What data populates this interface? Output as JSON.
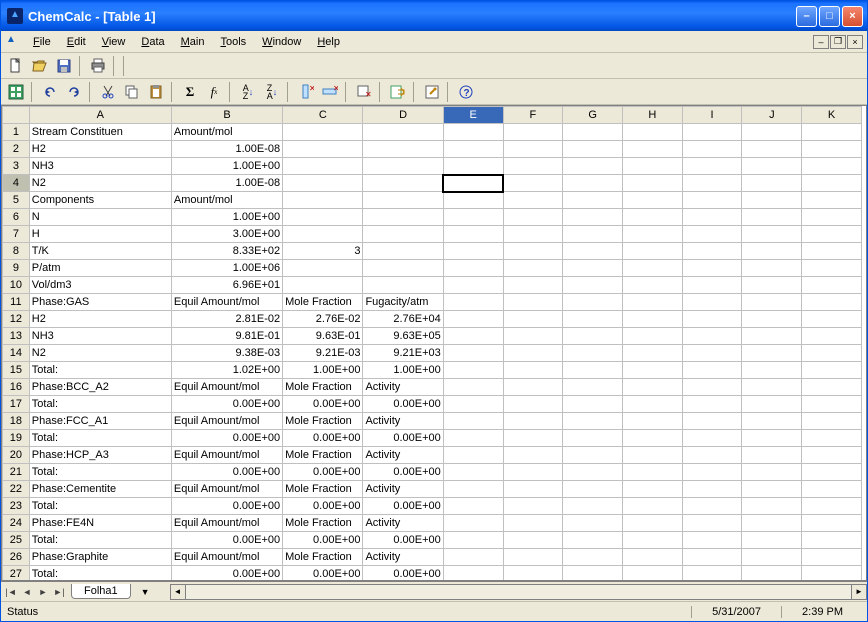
{
  "window": {
    "title": "ChemCalc - [Table 1]"
  },
  "menu": {
    "file": "File",
    "edit": "Edit",
    "view": "View",
    "data": "Data",
    "main": "Main",
    "tools": "Tools",
    "window": "Window",
    "help": "Help"
  },
  "cols": [
    "A",
    "B",
    "C",
    "D",
    "E",
    "F",
    "G",
    "H",
    "I",
    "J",
    "K"
  ],
  "rows": [
    {
      "n": 1,
      "A": "Stream Constituen",
      "B": "Amount/mol",
      "C": "",
      "D": ""
    },
    {
      "n": 2,
      "A": "H2",
      "B": "1.00E-08",
      "C": "",
      "D": ""
    },
    {
      "n": 3,
      "A": "NH3",
      "B": "1.00E+00",
      "C": "",
      "D": ""
    },
    {
      "n": 4,
      "A": "N2",
      "B": "1.00E-08",
      "C": "",
      "D": ""
    },
    {
      "n": 5,
      "A": "Components",
      "B": "Amount/mol",
      "C": "",
      "D": ""
    },
    {
      "n": 6,
      "A": "N",
      "B": "1.00E+00",
      "C": "",
      "D": ""
    },
    {
      "n": 7,
      "A": "H",
      "B": "3.00E+00",
      "C": "",
      "D": ""
    },
    {
      "n": 8,
      "A": "T/K",
      "B": "8.33E+02",
      "C": "3",
      "D": ""
    },
    {
      "n": 9,
      "A": "P/atm",
      "B": "1.00E+06",
      "C": "",
      "D": ""
    },
    {
      "n": 10,
      "A": "Vol/dm3",
      "B": "6.96E+01",
      "C": "",
      "D": ""
    },
    {
      "n": 11,
      "A": "Phase:GAS",
      "B": "Equil Amount/mol",
      "C": "Mole Fraction",
      "D": "Fugacity/atm"
    },
    {
      "n": 12,
      "A": "H2",
      "B": "2.81E-02",
      "C": "2.76E-02",
      "D": "2.76E+04"
    },
    {
      "n": 13,
      "A": "NH3",
      "B": "9.81E-01",
      "C": "9.63E-01",
      "D": "9.63E+05"
    },
    {
      "n": 14,
      "A": "N2",
      "B": "9.38E-03",
      "C": "9.21E-03",
      "D": "9.21E+03"
    },
    {
      "n": 15,
      "A": "Total:",
      "B": "1.02E+00",
      "C": "1.00E+00",
      "D": "1.00E+00"
    },
    {
      "n": 16,
      "A": "Phase:BCC_A2",
      "B": "Equil Amount/mol",
      "C": "Mole Fraction",
      "D": "Activity"
    },
    {
      "n": 17,
      "A": "Total:",
      "B": "0.00E+00",
      "C": "0.00E+00",
      "D": "0.00E+00"
    },
    {
      "n": 18,
      "A": "Phase:FCC_A1",
      "B": "Equil Amount/mol",
      "C": "Mole Fraction",
      "D": "Activity"
    },
    {
      "n": 19,
      "A": "Total:",
      "B": "0.00E+00",
      "C": "0.00E+00",
      "D": "0.00E+00"
    },
    {
      "n": 20,
      "A": "Phase:HCP_A3",
      "B": "Equil Amount/mol",
      "C": "Mole Fraction",
      "D": "Activity"
    },
    {
      "n": 21,
      "A": "Total:",
      "B": "0.00E+00",
      "C": "0.00E+00",
      "D": "0.00E+00"
    },
    {
      "n": 22,
      "A": "Phase:Cementite",
      "B": "Equil Amount/mol",
      "C": "Mole Fraction",
      "D": "Activity"
    },
    {
      "n": 23,
      "A": "Total:",
      "B": "0.00E+00",
      "C": "0.00E+00",
      "D": "0.00E+00"
    },
    {
      "n": 24,
      "A": "Phase:FE4N",
      "B": "Equil Amount/mol",
      "C": "Mole Fraction",
      "D": "Activity"
    },
    {
      "n": 25,
      "A": "Total:",
      "B": "0.00E+00",
      "C": "0.00E+00",
      "D": "0.00E+00"
    },
    {
      "n": 26,
      "A": "Phase:Graphite",
      "B": "Equil Amount/mol",
      "C": "Mole Fraction",
      "D": "Activity"
    },
    {
      "n": 27,
      "A": "Total:",
      "B": "0.00E+00",
      "C": "0.00E+00",
      "D": "0.00E+00"
    }
  ],
  "selected": {
    "row": 4,
    "col": "E"
  },
  "sheet_tab": "Folha1",
  "status": {
    "text": "Status",
    "date": "5/31/2007",
    "time": "2:39 PM"
  }
}
